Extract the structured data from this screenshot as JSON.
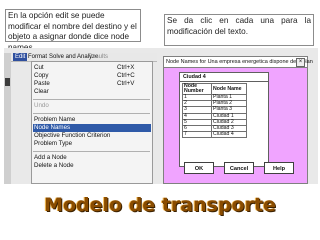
{
  "callouts": {
    "left": "En la opción edit se puede modificar el nombre del destino y el objeto a asignar donde dice node names.",
    "right": "Se da clic en cada una para la modificación del texto."
  },
  "menubar": {
    "edit": "Edit",
    "format": "Format",
    "solve": "Solve and Analyze",
    "results": "Results"
  },
  "edit_menu": {
    "cut": {
      "label": "Cut",
      "shortcut": "Ctrl+X"
    },
    "copy": {
      "label": "Copy",
      "shortcut": "Ctrl+C"
    },
    "paste": {
      "label": "Paste",
      "shortcut": "Ctrl+V"
    },
    "clear": {
      "label": "Clear"
    },
    "undo": {
      "label": "Undo"
    },
    "problem_name": {
      "label": "Problem Name"
    },
    "node_names": {
      "label": "Node Names"
    },
    "objective": {
      "label": "Objective Function Criterion"
    },
    "problem_type": {
      "label": "Problem Type"
    },
    "add_node": {
      "label": "Add a Node"
    },
    "delete_node": {
      "label": "Delete a Node"
    }
  },
  "dialog": {
    "title": "Node Names for Una empresa energetica dispone de 3 plan",
    "close": "×",
    "cell_value": "Ciudad 4",
    "columns": [
      "Node Number",
      "Node Name"
    ],
    "rows": [
      {
        "number": "1",
        "name": "Planta 1"
      },
      {
        "number": "2",
        "name": "Planta 2"
      },
      {
        "number": "3",
        "name": "Planta 3"
      },
      {
        "number": "4",
        "name": "Ciudad 1"
      },
      {
        "number": "5",
        "name": "Ciudad 2"
      },
      {
        "number": "6",
        "name": "Ciudad 3"
      },
      {
        "number": "7",
        "name": "Ciudad 4"
      }
    ],
    "ok": "OK",
    "cancel": "Cancel",
    "help": "Help"
  },
  "banner": "Modelo de transporte",
  "colors": {
    "dialog_bg": "#f0a4ff",
    "menu_highlight": "#2f5aa8",
    "banner": "#8a4c00"
  }
}
